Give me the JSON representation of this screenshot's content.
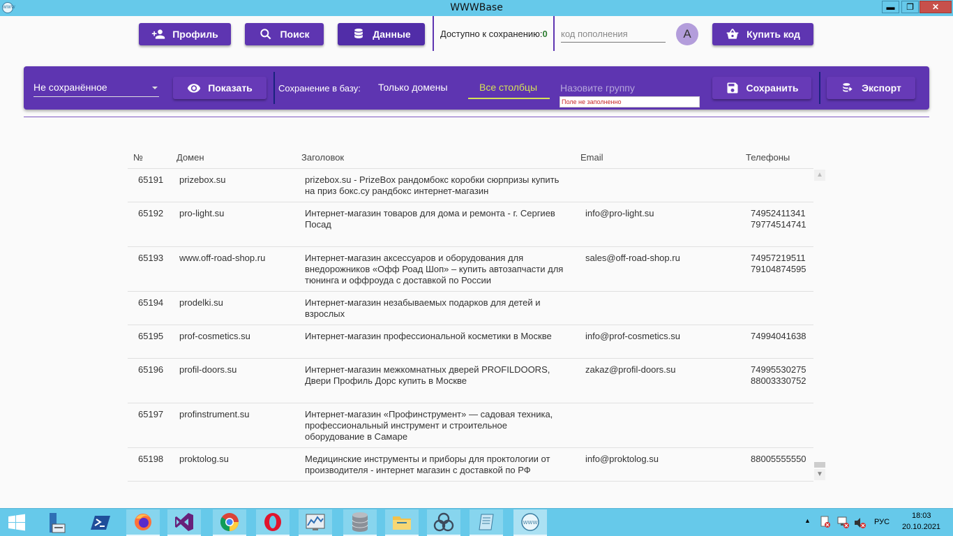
{
  "window": {
    "title": "WWWBase",
    "icon_label": "WWW",
    "minimize": "▬",
    "maximize": "❐",
    "close": "✕"
  },
  "topbar": {
    "profile_label": "Профиль",
    "search_label": "Поиск",
    "data_label": "Данные",
    "available_label": "Доступно к сохранению:",
    "available_count": "0",
    "code_placeholder": "код пополнения",
    "avatar_letter": "A",
    "buy_label": "Купить код"
  },
  "panel": {
    "select_value": "Не сохранённое",
    "show_label": "Показать",
    "save_to_db_label": "Сохранение в базу:",
    "tab_domains": "Только домены",
    "tab_all": "Все столбцы",
    "group_placeholder": "Назовите группу",
    "group_error": "Поле не заполненно",
    "save_label": "Сохранить",
    "export_label": "Экспорт"
  },
  "table": {
    "headers": {
      "id": "№",
      "domain": "Домен",
      "title": "Заголовок",
      "email": "Email",
      "phones": "Телефоны"
    },
    "rows": [
      {
        "id": "65191",
        "domain": "prizebox.su",
        "title_lines": [
          "prizebox.su - PrizeBox рандомбокс коробки сюрпризы купить",
          "на приз бокс.су  рандбокс интернет-магазин"
        ],
        "email": "",
        "phones": []
      },
      {
        "id": "65192",
        "domain": "pro-light.su",
        "title_lines": [
          "Интернет-магазин товаров для дома и ремонта - г. Сергиев",
          "Посад"
        ],
        "email": "info@pro-light.su",
        "phones": [
          "74952411341",
          "79774514741"
        ]
      },
      {
        "id": "65193",
        "domain": "www.off-road-shop.ru",
        "title_lines": [
          "Интернет-магазин аксессуаров и оборудования для",
          "внедорожников «Офф Роад Шоп» – купить автозапчасти для",
          "тюнинга и оффроуда с доставкой по России"
        ],
        "email": "sales@off-road-shop.ru",
        "phones": [
          "74957219511",
          "79104874595"
        ]
      },
      {
        "id": "65194",
        "domain": "prodelki.su",
        "title_lines": [
          "Интернет-магазин незабываемых подарков для детей и",
          "взрослых"
        ],
        "email": "",
        "phones": []
      },
      {
        "id": "65195",
        "domain": "prof-cosmetics.su",
        "title_lines": [
          "Интернет-магазин профессиональной косметики в Москве"
        ],
        "email": "info@prof-cosmetics.su",
        "phones": [
          "74994041638"
        ]
      },
      {
        "id": "65196",
        "domain": "profil-doors.su",
        "title_lines": [
          "Интернет-магазин межкомнатных дверей PROFILDOORS,",
          "Двери Профиль Дорс купить в Москве"
        ],
        "email": "zakaz@profil-doors.su",
        "phones": [
          "74995530275",
          "88003330752"
        ]
      },
      {
        "id": "65197",
        "domain": "profinstrument.su",
        "title_lines": [
          "Интернет-магазин «Профинструмент» — садовая техника,",
          "профессиональный инструмент и строительное",
          "оборудование в Самаре"
        ],
        "email": "",
        "phones": []
      },
      {
        "id": "65198",
        "domain": "proktolog.su",
        "title_lines": [
          "Медицинские инструменты и приборы для проктологии от",
          "производителя - интернет магазин с доставкой по РФ"
        ],
        "email": "info@proktolog.su",
        "phones": [
          "88005555550"
        ]
      }
    ]
  },
  "taskbar": {
    "apps": [
      "start-icon",
      "server-manager-icon",
      "powershell-icon",
      "firefox-icon",
      "visual-studio-icon",
      "chrome-icon",
      "opera-icon",
      "performance-monitor-icon",
      "database-icon",
      "file-explorer-icon",
      "network-icon",
      "notepad-icon",
      "wwwbase-app-icon"
    ],
    "language": "РУС",
    "time": "18:03",
    "date": "20.10.2021"
  },
  "colors": {
    "accent": "#5e35b1",
    "active_tab": "#d4e157",
    "titlebar": "#66c9ea",
    "available_count": "#2e7d32",
    "error": "#c62828"
  }
}
